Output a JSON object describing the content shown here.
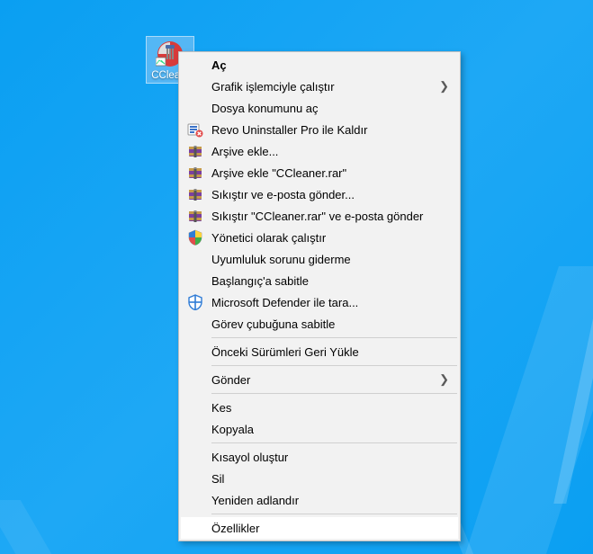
{
  "desktop": {
    "icon_label": "CClea..."
  },
  "menu": {
    "items": [
      {
        "label": "Aç",
        "bold": true,
        "icon": null,
        "submenu": false,
        "sep_after": false
      },
      {
        "label": "Grafik işlemciyle çalıştır",
        "icon": null,
        "submenu": true,
        "sep_after": false
      },
      {
        "label": "Dosya konumunu aç",
        "icon": null,
        "submenu": false,
        "sep_after": false
      },
      {
        "label": "Revo Uninstaller Pro ile Kaldır",
        "icon": "revo",
        "submenu": false,
        "sep_after": false
      },
      {
        "label": "Arşive ekle...",
        "icon": "rar",
        "submenu": false,
        "sep_after": false
      },
      {
        "label": "Arşive ekle \"CCleaner.rar\"",
        "icon": "rar",
        "submenu": false,
        "sep_after": false
      },
      {
        "label": "Sıkıştır ve e-posta gönder...",
        "icon": "rar",
        "submenu": false,
        "sep_after": false
      },
      {
        "label": "Sıkıştır \"CCleaner.rar\" ve e-posta gönder",
        "icon": "rar",
        "submenu": false,
        "sep_after": false
      },
      {
        "label": "Yönetici olarak çalıştır",
        "icon": "shield",
        "submenu": false,
        "sep_after": false
      },
      {
        "label": "Uyumluluk sorunu giderme",
        "icon": null,
        "submenu": false,
        "sep_after": false
      },
      {
        "label": "Başlangıç'a sabitle",
        "icon": null,
        "submenu": false,
        "sep_after": false
      },
      {
        "label": "Microsoft Defender ile tara...",
        "icon": "defender",
        "submenu": false,
        "sep_after": false
      },
      {
        "label": "Görev çubuğuna sabitle",
        "icon": null,
        "submenu": false,
        "sep_after": true
      },
      {
        "label": "Önceki Sürümleri Geri Yükle",
        "icon": null,
        "submenu": false,
        "sep_after": true
      },
      {
        "label": "Gönder",
        "icon": null,
        "submenu": true,
        "sep_after": true
      },
      {
        "label": "Kes",
        "icon": null,
        "submenu": false,
        "sep_after": false
      },
      {
        "label": "Kopyala",
        "icon": null,
        "submenu": false,
        "sep_after": true
      },
      {
        "label": "Kısayol oluştur",
        "icon": null,
        "submenu": false,
        "sep_after": false
      },
      {
        "label": "Sil",
        "icon": null,
        "submenu": false,
        "sep_after": false
      },
      {
        "label": "Yeniden adlandır",
        "icon": null,
        "submenu": false,
        "sep_after": true
      },
      {
        "label": "Özellikler",
        "icon": null,
        "submenu": false,
        "sep_after": false,
        "highlight": true
      }
    ]
  }
}
